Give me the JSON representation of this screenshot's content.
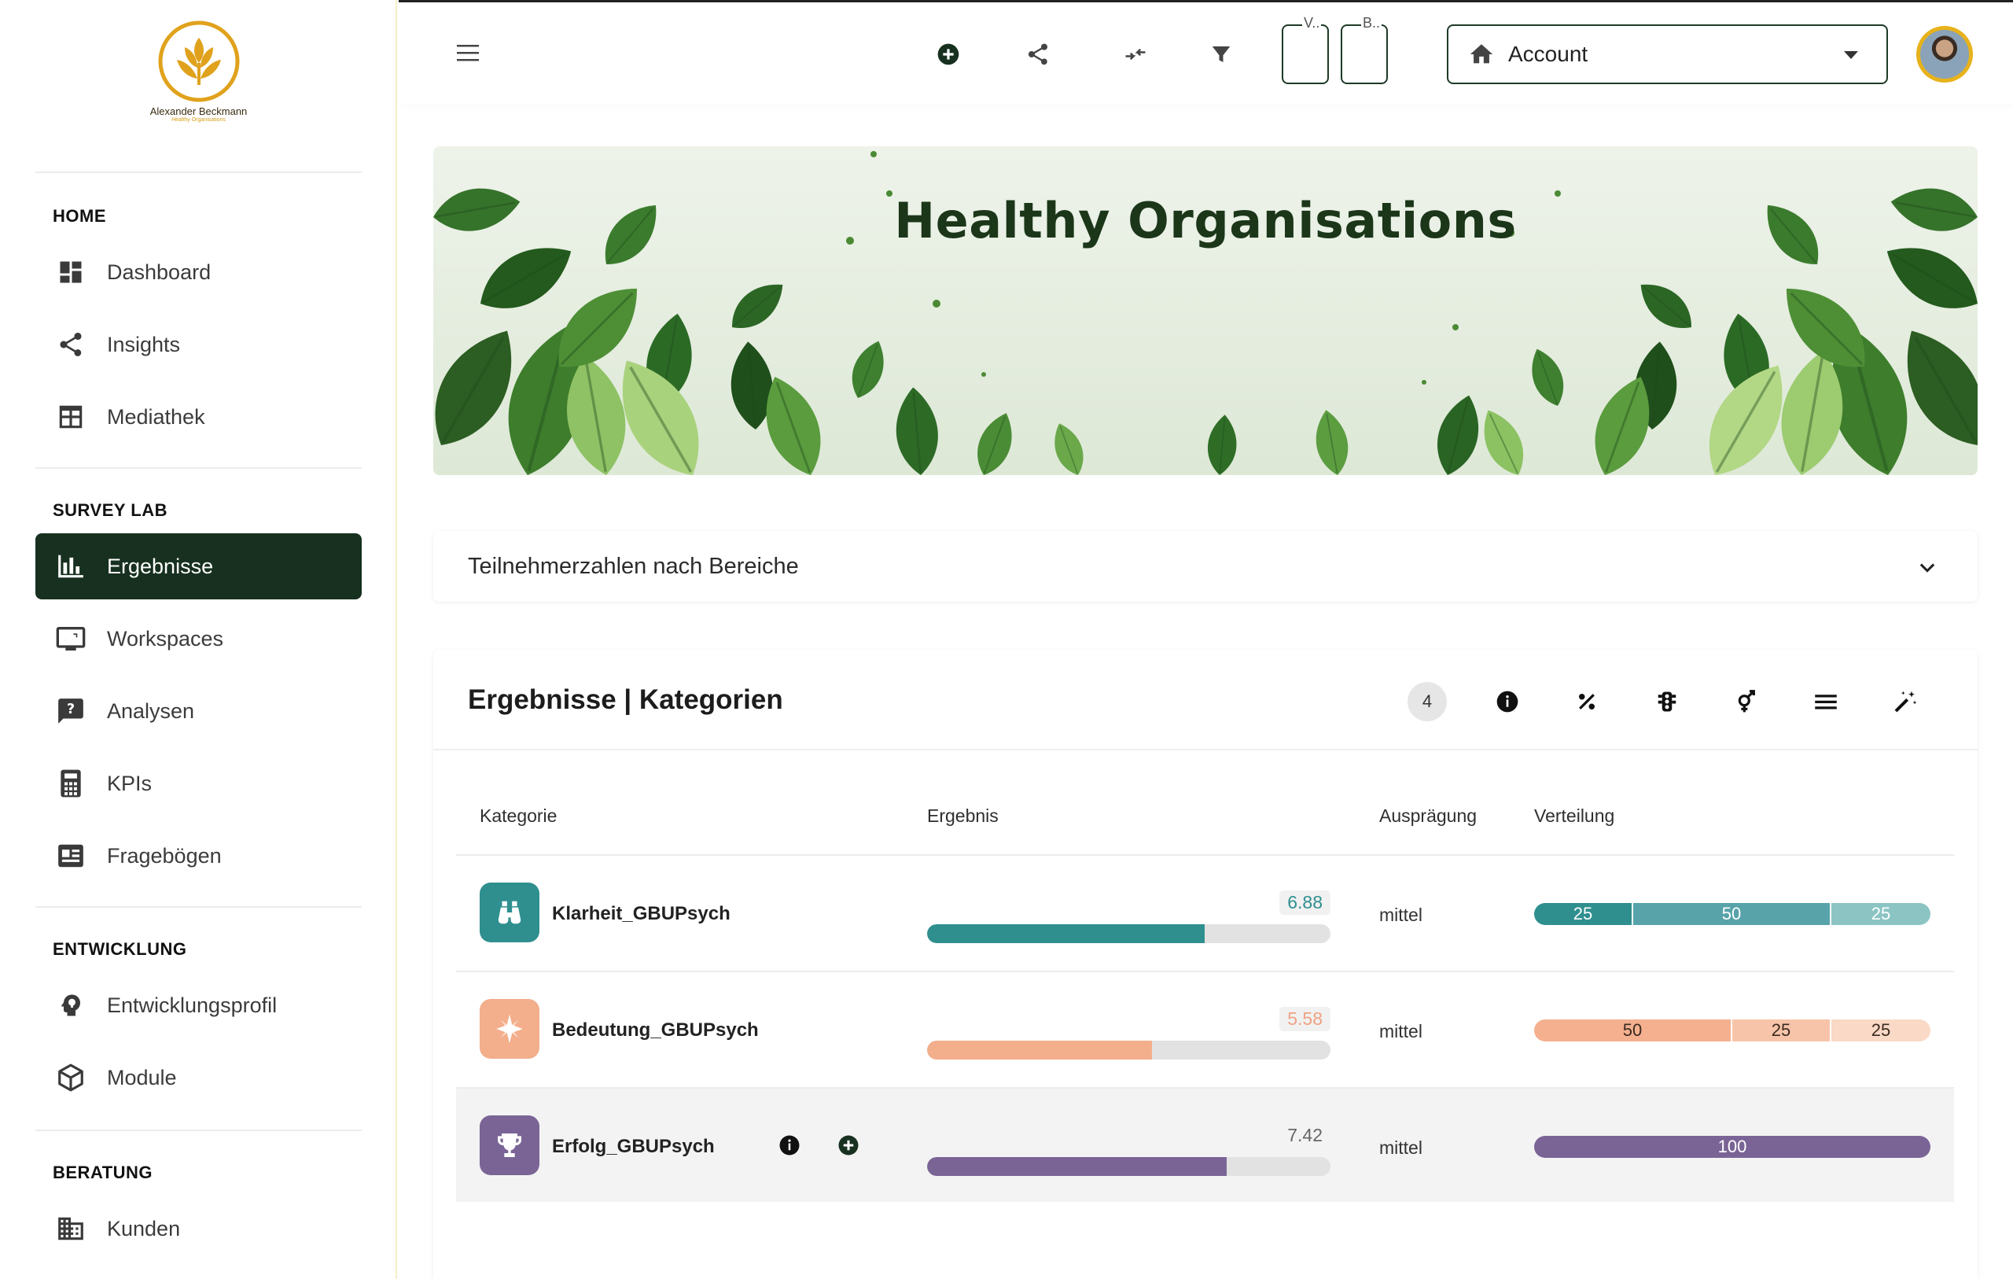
{
  "brand": {
    "name": "Alexander Beckmann",
    "sub": "Healthy Organisations"
  },
  "sidebar": {
    "sections": [
      {
        "title": "HOME",
        "items": [
          {
            "label": "Dashboard",
            "icon": "dashboard-icon"
          },
          {
            "label": "Insights",
            "icon": "share-icon"
          },
          {
            "label": "Mediathek",
            "icon": "table-icon"
          }
        ]
      },
      {
        "title": "SURVEY LAB",
        "items": [
          {
            "label": "Ergebnisse",
            "icon": "bar-chart-icon",
            "active": true
          },
          {
            "label": "Workspaces",
            "icon": "monitor-icon"
          },
          {
            "label": "Analysen",
            "icon": "question-chat-icon"
          },
          {
            "label": "KPIs",
            "icon": "calculator-icon"
          },
          {
            "label": "Fragebögen",
            "icon": "newspaper-icon"
          }
        ]
      },
      {
        "title": "ENTWICKLUNG",
        "items": [
          {
            "label": "Entwicklungsprofil",
            "icon": "head-bulb-icon"
          },
          {
            "label": "Module",
            "icon": "cube-icon"
          }
        ]
      },
      {
        "title": "BERATUNG",
        "items": [
          {
            "label": "Kunden",
            "icon": "building-icon"
          }
        ]
      }
    ]
  },
  "topbar": {
    "fields": [
      {
        "label": "V.."
      },
      {
        "label": "B.."
      }
    ],
    "account_label": "Account",
    "icons": [
      "add-circle-icon",
      "share-icon",
      "compress-icon",
      "filter-icon"
    ]
  },
  "banner": {
    "title": "Healthy Organisations"
  },
  "accordion": {
    "label": "Teilnehmerzahlen nach Bereiche"
  },
  "results": {
    "title": "Ergebnisse | Kategorien",
    "count": "4",
    "header_icons": [
      "info-icon",
      "percent-icon",
      "traffic-light-icon",
      "gender-icon",
      "menu-icon",
      "magic-wand-icon"
    ],
    "columns": {
      "kategorie": "Kategorie",
      "ergebnis": "Ergebnis",
      "auspraegung": "Ausprägung",
      "verteilung": "Verteilung"
    },
    "rows": [
      {
        "name": "Klarheit_GBUPsych",
        "icon": "binoculars-icon",
        "score": "6.88",
        "fraction": 0.688,
        "auspraegung": "mittel",
        "color": "#2f8f8f",
        "track_label_color": "#2f8f8f",
        "distribution": [
          {
            "value": "25",
            "color": "#2f8f8f"
          },
          {
            "value": "50",
            "color": "#58a3aa"
          },
          {
            "value": "25",
            "color": "#8cc4c4"
          }
        ]
      },
      {
        "name": "Bedeutung_GBUPsych",
        "icon": "compass-icon",
        "score": "5.58",
        "fraction": 0.558,
        "auspraegung": "mittel",
        "color": "#f3ae8b",
        "track_label_color": "#f0a283",
        "distribution": [
          {
            "value": "50",
            "color": "#f4b08f"
          },
          {
            "value": "25",
            "color": "#f7c4aa"
          },
          {
            "value": "25",
            "color": "#fad9c6"
          }
        ]
      },
      {
        "name": "Erfolg_GBUPsych",
        "icon": "trophy-icon",
        "score": "7.42",
        "fraction": 0.742,
        "auspraegung": "mittel",
        "color": "#7a6496",
        "track_label_color": "#666",
        "distribution": [
          {
            "value": "100",
            "color": "#7a6496"
          }
        ]
      }
    ]
  }
}
